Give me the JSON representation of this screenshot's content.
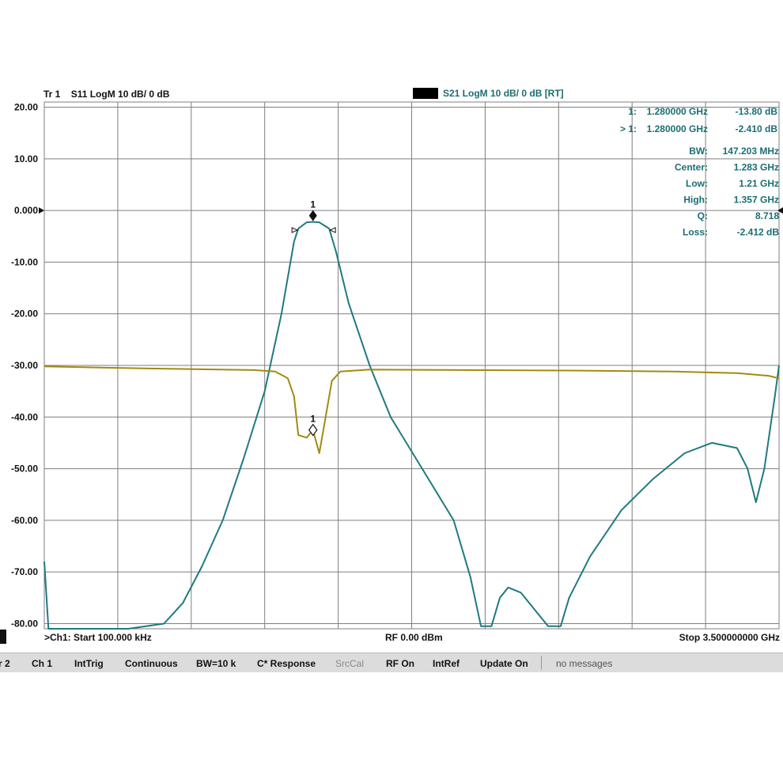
{
  "trace_header": {
    "tr1_label": "Tr 1",
    "s11_label": "S11 LogM 10 dB/ 0 dB",
    "s21_label": "S21 LogM 10 dB/ 0 dB [RT]"
  },
  "marker_readout": {
    "rows": [
      {
        "label": "1:",
        "freq": "1.280000 GHz",
        "value": "-13.80 dB"
      },
      {
        "label": "> 1:",
        "freq": "1.280000 GHz",
        "value": "-2.410 dB"
      }
    ],
    "stats": [
      {
        "label": "BW:",
        "value": "147.203 MHz"
      },
      {
        "label": "Center:",
        "value": "1.283 GHz"
      },
      {
        "label": "Low:",
        "value": "1.21 GHz"
      },
      {
        "label": "High:",
        "value": "1.357 GHz"
      },
      {
        "label": "Q:",
        "value": "8.718"
      },
      {
        "label": "Loss:",
        "value": "-2.412 dB"
      }
    ]
  },
  "footer": {
    "start": ">Ch1: Start 100.000 kHz",
    "rf": "RF 0.00 dBm",
    "stop": "Stop 3.500000000 GHz"
  },
  "status_bar": {
    "items": [
      "r 2",
      "Ch 1",
      "IntTrig",
      "Continuous",
      "BW=10 k",
      "C* Response",
      "SrcCal",
      "RF On",
      "IntRef",
      "Update On",
      "no messages"
    ]
  },
  "colors": {
    "s21_trace": "#1f7a80",
    "s11_trace": "#a38a12",
    "grid": "#7f7f7f",
    "text": "#111111"
  },
  "chart_data": {
    "type": "line",
    "x_range_ghz": [
      0.0001,
      3.5
    ],
    "ylim": [
      -81,
      21
    ],
    "y_ticks": [
      "20.00",
      "10.00",
      "0.000",
      "-10.00",
      "-20.00",
      "-30.00",
      "-40.00",
      "-50.00",
      "-60.00",
      "-70.00",
      "-80.00"
    ],
    "y_tick_values": [
      20,
      10,
      0,
      -10,
      -20,
      -30,
      -40,
      -50,
      -60,
      -70,
      -80
    ],
    "x_divisions": 10,
    "grid": true,
    "markers": [
      {
        "label": "1",
        "trace": "S21",
        "x": 1.28,
        "y": -1.0
      },
      {
        "label": "1",
        "trace": "S11",
        "x": 1.28,
        "y": -42.5
      }
    ],
    "series": [
      {
        "name": "S21",
        "color": "#1f7a80",
        "points": [
          [
            0.0,
            -68
          ],
          [
            0.02,
            -81
          ],
          [
            0.15,
            -81
          ],
          [
            0.4,
            -81
          ],
          [
            0.57,
            -80
          ],
          [
            0.66,
            -76
          ],
          [
            0.75,
            -69
          ],
          [
            0.85,
            -60
          ],
          [
            0.95,
            -48
          ],
          [
            1.05,
            -35
          ],
          [
            1.13,
            -20
          ],
          [
            1.19,
            -6
          ],
          [
            1.21,
            -3.5
          ],
          [
            1.25,
            -2.3
          ],
          [
            1.28,
            -2.2
          ],
          [
            1.31,
            -2.3
          ],
          [
            1.357,
            -3.5
          ],
          [
            1.39,
            -8
          ],
          [
            1.45,
            -18
          ],
          [
            1.55,
            -30
          ],
          [
            1.65,
            -40
          ],
          [
            1.8,
            -50
          ],
          [
            1.95,
            -60
          ],
          [
            2.03,
            -71
          ],
          [
            2.08,
            -80.5
          ],
          [
            2.13,
            -80.5
          ],
          [
            2.17,
            -75
          ],
          [
            2.21,
            -73
          ],
          [
            2.27,
            -74
          ],
          [
            2.35,
            -78
          ],
          [
            2.4,
            -80.5
          ],
          [
            2.46,
            -80.5
          ],
          [
            2.5,
            -75
          ],
          [
            2.6,
            -67
          ],
          [
            2.75,
            -58
          ],
          [
            2.9,
            -52
          ],
          [
            3.05,
            -47
          ],
          [
            3.18,
            -45
          ],
          [
            3.3,
            -46
          ],
          [
            3.35,
            -50
          ],
          [
            3.39,
            -56.5
          ],
          [
            3.43,
            -50
          ],
          [
            3.48,
            -36
          ],
          [
            3.5,
            -30
          ]
        ]
      },
      {
        "name": "S11",
        "color": "#a38a12",
        "points": [
          [
            0.0,
            -30.2
          ],
          [
            0.5,
            -30.6
          ],
          [
            1.0,
            -30.9
          ],
          [
            1.1,
            -31.2
          ],
          [
            1.16,
            -32.5
          ],
          [
            1.19,
            -36
          ],
          [
            1.21,
            -43.5
          ],
          [
            1.25,
            -44
          ],
          [
            1.28,
            -42.5
          ],
          [
            1.31,
            -47
          ],
          [
            1.34,
            -40
          ],
          [
            1.37,
            -33
          ],
          [
            1.41,
            -31.2
          ],
          [
            1.55,
            -30.8
          ],
          [
            2.0,
            -30.9
          ],
          [
            2.5,
            -31.0
          ],
          [
            3.0,
            -31.2
          ],
          [
            3.3,
            -31.5
          ],
          [
            3.45,
            -32
          ],
          [
            3.5,
            -32.5
          ]
        ]
      }
    ]
  }
}
